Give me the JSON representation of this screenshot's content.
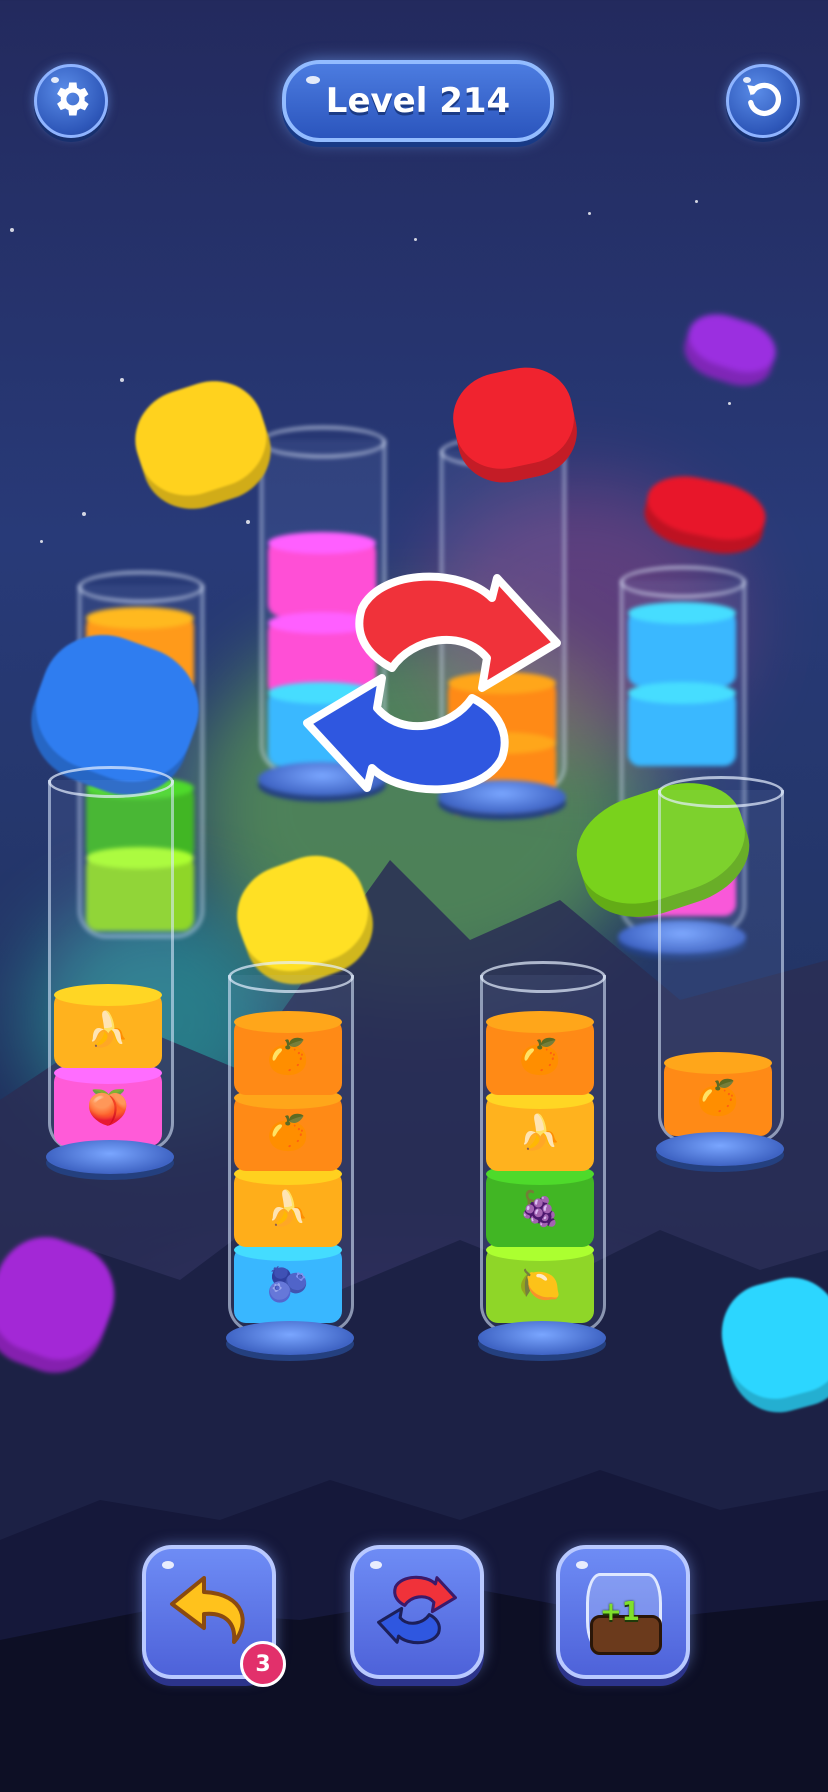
{
  "header": {
    "level_label": "Level 214",
    "settings_icon": "gear-icon",
    "restart_icon": "restart-icon"
  },
  "tubes": [
    {
      "id": "tube-1",
      "layers": [
        {
          "color": "#ff5bd8",
          "fruit_icon": "peach-icon",
          "glyph": "🍑"
        },
        {
          "color": "#ffb21e",
          "fruit_icon": "banana-icon",
          "glyph": "🍌"
        }
      ]
    },
    {
      "id": "tube-2",
      "layers": [
        {
          "color": "#39b7ff",
          "fruit_icon": "blueberry-icon",
          "glyph": "🫐"
        },
        {
          "color": "#ffae1a",
          "fruit_icon": "banana-icon",
          "glyph": "🍌"
        },
        {
          "color": "#ff8a16",
          "fruit_icon": "orange-icon",
          "glyph": "🍊"
        },
        {
          "color": "#ff8a16",
          "fruit_icon": "orange-icon",
          "glyph": "🍊"
        }
      ]
    },
    {
      "id": "tube-3",
      "layers": [
        {
          "color": "#8fd628",
          "fruit_icon": "lime-icon",
          "glyph": "🍋"
        },
        {
          "color": "#41b624",
          "fruit_icon": "grape-leaf-icon",
          "glyph": "🍇"
        },
        {
          "color": "#ffb21e",
          "fruit_icon": "banana-icon",
          "glyph": "🍌"
        },
        {
          "color": "#ff8a16",
          "fruit_icon": "orange-icon",
          "glyph": "🍊"
        }
      ]
    },
    {
      "id": "tube-4",
      "layers": [
        {
          "color": "#ff8a16",
          "fruit_icon": "orange-icon",
          "glyph": "🍊"
        }
      ]
    }
  ],
  "boosters": {
    "undo": {
      "icon": "undo-icon",
      "count": "3"
    },
    "shuffle": {
      "icon": "shuffle-icon"
    },
    "add_tube": {
      "icon": "add-tube-icon",
      "label": "+1"
    }
  },
  "colors": {
    "button_blue": "#4e62d9",
    "badge_pink": "#e2306b",
    "shuffle_red": "#f0323a",
    "shuffle_blue": "#2f57e0"
  }
}
